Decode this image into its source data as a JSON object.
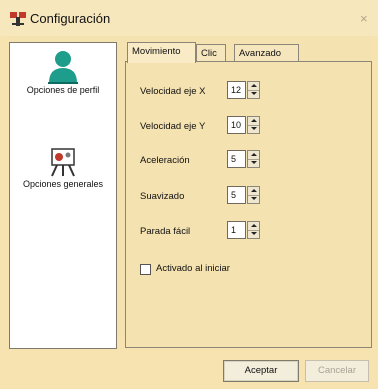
{
  "window": {
    "title": "Configuración",
    "close_glyph": "×"
  },
  "sidebar": {
    "items": [
      {
        "label": "Opciones de perfil",
        "icon": "user-profile-icon"
      },
      {
        "label": "Opciones generales",
        "icon": "general-options-icon"
      }
    ]
  },
  "tabs": [
    {
      "label": "Movimiento",
      "active": true
    },
    {
      "label": "Clic",
      "active": false
    },
    {
      "label": "Avanzado",
      "active": false
    }
  ],
  "movement": {
    "fields": [
      {
        "label": "Velocidad eje X",
        "value": "12"
      },
      {
        "label": "Velocidad eje Y",
        "value": "10"
      },
      {
        "label": "Aceleración",
        "value": "5"
      },
      {
        "label": "Suavizado",
        "value": "5"
      },
      {
        "label": "Parada fácil",
        "value": "1"
      }
    ],
    "checkbox": {
      "label": "Activado al iniciar",
      "checked": false
    }
  },
  "buttons": {
    "ok": "Aceptar",
    "cancel": "Cancelar"
  },
  "colors": {
    "background": "#f6e3b0",
    "sidebar": "#ffffff",
    "profile_icon": "#1f9d8c"
  }
}
